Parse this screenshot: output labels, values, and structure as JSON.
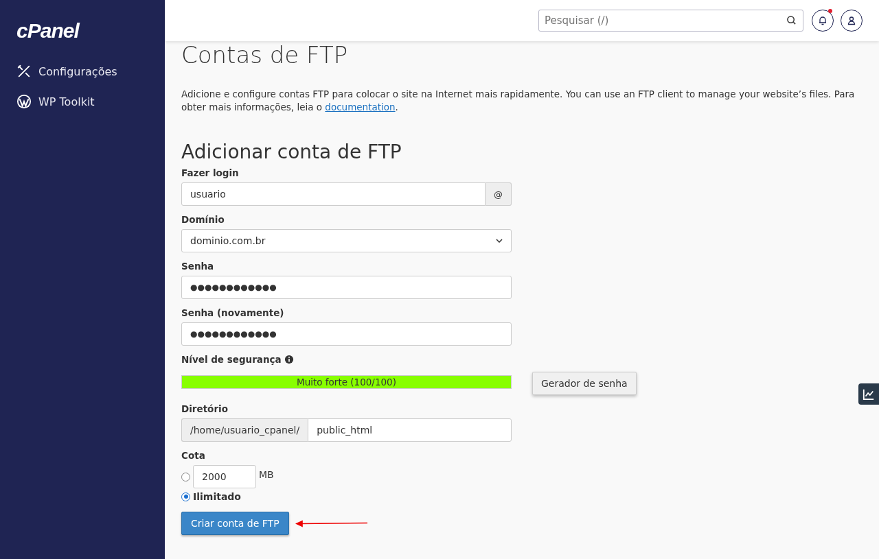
{
  "sidebar": {
    "logo": "cPanel",
    "items": [
      {
        "label": "Configurações",
        "kind": "tools"
      },
      {
        "label": "WP Toolkit",
        "kind": "wordpress"
      }
    ]
  },
  "header": {
    "search": {
      "placeholder": "Pesquisar (/)"
    },
    "notifications": {
      "unread": true
    }
  },
  "page": {
    "title": "Contas de FTP",
    "intro": "Adicione e configure contas FTP para colocar o site na Internet mais rapidamente. You can use an FTP client to manage your website’s files. Para obter mais informações, leia o ",
    "intro_link": "documentation",
    "intro_end": "."
  },
  "form": {
    "title": "Adicionar conta de FTP",
    "login": {
      "label": "Fazer login",
      "value": "usuario",
      "addon": "@"
    },
    "domain": {
      "label": "Domínio",
      "value": "dominio.com.br"
    },
    "password": {
      "label": "Senha",
      "value": "●●●●●●●●●●●●"
    },
    "password_again": {
      "label": "Senha (novamente)",
      "value": "●●●●●●●●●●●●"
    },
    "strength": {
      "label": "Nível de segurança",
      "level": 1,
      "text": "Muito forte (100/100)"
    },
    "generator_button": "Gerador de senha",
    "directory": {
      "label": "Diretório",
      "prefix": "/home/usuario_cpanel/",
      "value": "public_html"
    },
    "quota": {
      "label": "Cota",
      "options": [
        {
          "kind": "amount",
          "value": "2000",
          "unit": "MB",
          "selected": false
        },
        {
          "kind": "unlimited",
          "label": "Ilimitado",
          "selected": true
        }
      ]
    },
    "submit": "Criar conta de FTP"
  }
}
